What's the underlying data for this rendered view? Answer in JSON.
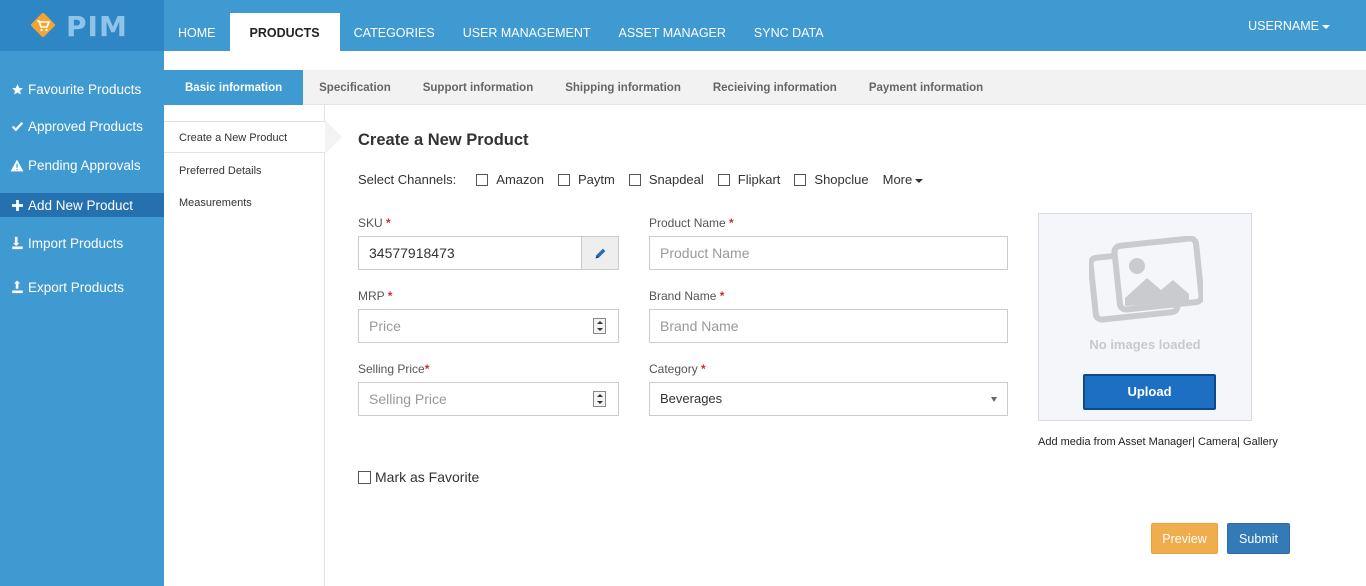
{
  "app": {
    "logo_text": "PIM",
    "brand_color": "#3f9ad1"
  },
  "nav": {
    "items": [
      {
        "label": "HOME"
      },
      {
        "label": "PRODUCTS",
        "active": true
      },
      {
        "label": "CATEGORIES"
      },
      {
        "label": "USER MANAGEMENT"
      },
      {
        "label": "ASSET MANAGER"
      },
      {
        "label": "SYNC DATA"
      }
    ],
    "user_label": "USERNAME"
  },
  "sidebar": {
    "items": [
      {
        "label": "Favourite Products",
        "icon": "star-icon"
      },
      {
        "label": "Approved Products",
        "icon": "check-icon"
      },
      {
        "label": "Pending Approvals",
        "icon": "warning-icon"
      },
      {
        "label": "Add New Product",
        "icon": "plus-icon",
        "active": true
      },
      {
        "label": "Import Products",
        "icon": "import-icon"
      },
      {
        "label": "Export Products",
        "icon": "export-icon"
      }
    ]
  },
  "tabs": [
    {
      "label": "Basic information",
      "active": true
    },
    {
      "label": "Specification"
    },
    {
      "label": "Support information"
    },
    {
      "label": "Shipping information"
    },
    {
      "label": "Recieiving information"
    },
    {
      "label": "Payment information"
    }
  ],
  "subnav": {
    "items": [
      {
        "label": "Create a New Product",
        "active": true
      },
      {
        "label": "Preferred Details"
      },
      {
        "label": "Measurements"
      }
    ]
  },
  "form": {
    "title": "Create a New Product",
    "channels_label": "Select Channels:",
    "channels": [
      "Amazon",
      "Paytm",
      "Snapdeal",
      "Flipkart",
      "Shopclue"
    ],
    "more_label": "More",
    "sku": {
      "label": "SKU",
      "value": "34577918473"
    },
    "mrp": {
      "label": "MRP",
      "placeholder": "Price"
    },
    "selling_price": {
      "label": "Selling Price",
      "placeholder": "Selling Price"
    },
    "product_name": {
      "label": "Product Name",
      "placeholder": "Product Name"
    },
    "brand_name": {
      "label": "Brand Name",
      "placeholder": "Brand Name"
    },
    "category": {
      "label": "Category",
      "value": "Beverages"
    },
    "favorite_label": "Mark as Favorite",
    "required_mark": "*"
  },
  "image_panel": {
    "empty_text": "No images loaded",
    "upload_label": "Upload",
    "media_asset_manager": "Add media from Asset Manager",
    "media_camera": "Camera",
    "media_gallery": "Gallery",
    "separator": "|"
  },
  "actions": {
    "preview_label": "Preview",
    "submit_label": "Submit"
  }
}
